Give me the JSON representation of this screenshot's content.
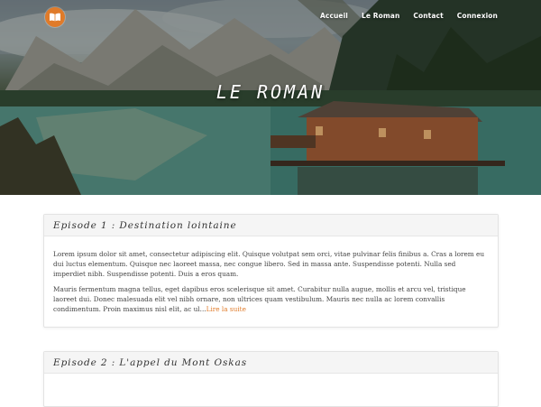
{
  "nav": {
    "items": [
      {
        "label": "Accueil"
      },
      {
        "label": "Le Roman"
      },
      {
        "label": "Contact"
      },
      {
        "label": "Connexion"
      }
    ]
  },
  "hero": {
    "title": "LE ROMAN"
  },
  "logo": {
    "icon": "book-icon",
    "color": "#e07b2a"
  },
  "episodes": [
    {
      "title": "Episode 1 : Destination lointaine",
      "paragraph1": "Lorem ipsum dolor sit amet, consectetur adipiscing elit. Quisque volutpat sem orci, vitae pulvinar felis finibus a. Cras a lorem eu dui luctus elementum. Quisque nec laoreet massa, nec congue libero. Sed in massa ante. Suspendisse potenti. Nulla sed imperdiet nibh. Suspendisse potenti. Duis a eros quam.",
      "paragraph2": "Mauris fermentum magna tellus, eget dapibus eros scelerisque sit amet. Curabitur nulla augue, mollis et arcu vel, tristique laoreet dui. Donec malesuada elit vel nibh ornare, non ultrices quam vestibulum. Mauris nec nulla ac lorem convallis condimentum. Proin maximus nisl elit, ac ul...",
      "more_label": "Lire la suite"
    },
    {
      "title": "Episode 2 : L'appel du Mont Oskas"
    }
  ],
  "colors": {
    "accent": "#e07b2a",
    "text": "#444444"
  }
}
